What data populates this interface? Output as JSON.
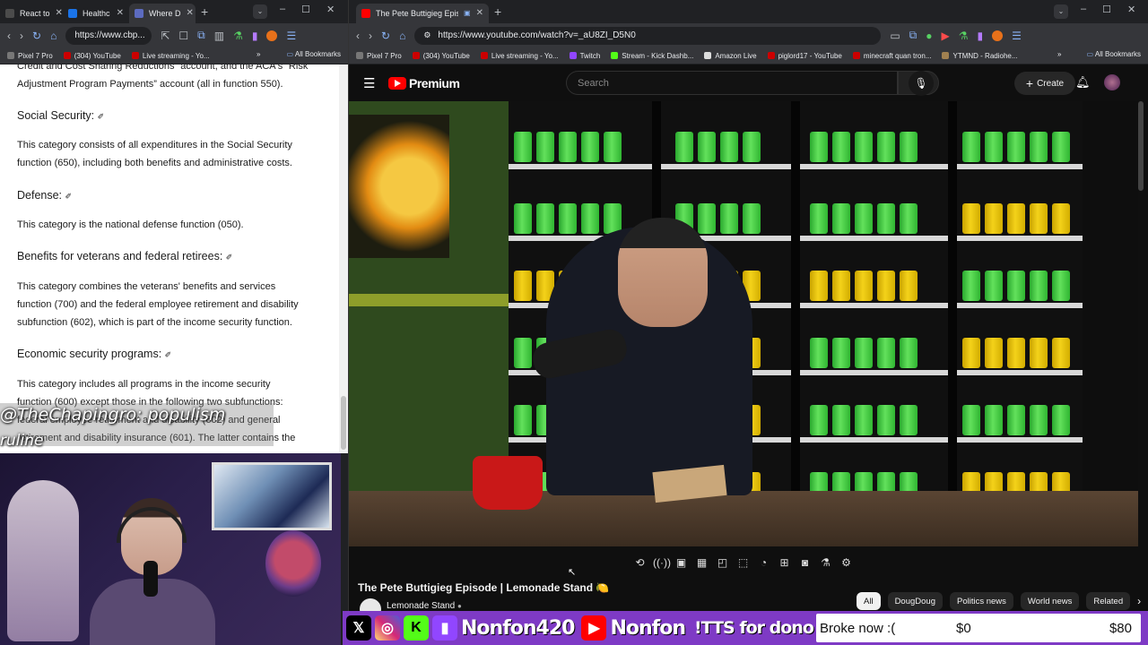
{
  "left_browser": {
    "tabs": [
      {
        "label": "React to",
        "color": "#4b4b4b"
      },
      {
        "label": "Healthc",
        "color": "#1a73e8"
      },
      {
        "label": "Where D",
        "color": "#5c6bc0",
        "active": true
      }
    ],
    "url": "https://www.cbp...",
    "bookmarks": [
      "Pixel 7 Pro",
      "(304) YouTube",
      "Live streaming - Yo..."
    ],
    "all_bookmarks": "All Bookmarks"
  },
  "article": {
    "top_text_1": "Credit and Cost Sharing Reductions” account, and the ACA's “Risk",
    "top_text_2": "Adjustment Program Payments” account (all in function 550).",
    "sections": [
      {
        "heading": "Social Security:",
        "body_1": "This category consists of all expenditures in the Social Security",
        "body_2": "function (650), including both benefits and administrative costs."
      },
      {
        "heading": "Defense:",
        "body_1": "This category is the national defense function (050)."
      },
      {
        "heading": "Benefits for veterans and federal retirees:",
        "body_1": "This category combines the veterans' benefits and services",
        "body_2": "function (700) and the federal employee retirement and disability",
        "body_3": "subfunction (602), which is part of the income security function."
      },
      {
        "heading": "Economic security programs:",
        "body_1": "This category includes all programs in the income security",
        "body_2": "function (600) except those in the following two subfunctions:",
        "body_3": "federal employee retirement and disability (602) and general",
        "body_4": "retirement and disability insurance (601). The latter contains the"
      }
    ],
    "link_glyph": "✐"
  },
  "stream_overlay": {
    "chat_line_1": "@TheChapingro: populism",
    "chat_line_2": "ruline"
  },
  "right_browser": {
    "tab_title": "The Pete Buttigieg Episode",
    "url": "https://www.youtube.com/watch?v=_aU8ZI_D5N0",
    "bookmarks": [
      "Pixel 7 Pro",
      "(304) YouTube",
      "Live streaming - Yo...",
      "Twitch",
      "Stream - Kick Dashb...",
      "Amazon Live",
      "piglord17 - YouTube",
      "minecraft quan tron...",
      "YTMND - Radiohe..."
    ],
    "all_bookmarks": "All Bookmarks"
  },
  "youtube": {
    "logo": "Premium",
    "search_placeholder": "Search",
    "create_label": "Create",
    "video_title": "The Pete Buttigieg Episode | Lemonade Stand 🍋",
    "channel": "Lemonade Stand",
    "chips": [
      "All",
      "DougDoug",
      "Politics news",
      "World news",
      "Related"
    ]
  },
  "banner": {
    "handle_1": "Nonfon420",
    "handle_2": "Nonfon",
    "tts": "!TTS for dono link",
    "goal_label": "Broke now :(",
    "goal_current": "$0",
    "goal_target": "$80"
  },
  "colors": {
    "youtube_red": "#ff0000",
    "banner_purple": "#7e3ac5"
  }
}
